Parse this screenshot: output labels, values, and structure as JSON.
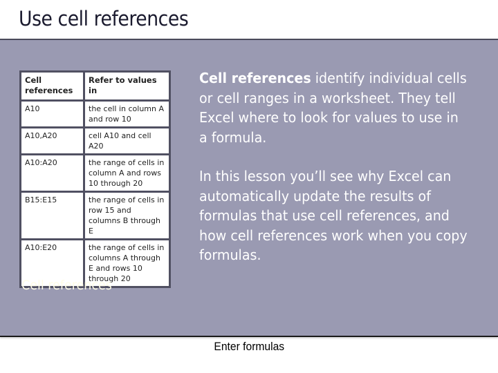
{
  "slide": {
    "title": "Use cell references",
    "table": {
      "headers": [
        "Cell references",
        "Refer to values in"
      ],
      "rows": [
        [
          "A10",
          "the cell in column A and row 10"
        ],
        [
          "A10,A20",
          "cell A10 and cell A20"
        ],
        [
          "A10:A20",
          "the range of cells in column A and rows 10 through 20"
        ],
        [
          "B15:E15",
          "the range of cells in row 15 and columns B through E"
        ],
        [
          "A10:E20",
          "the range of cells in columns A through E and rows 10 through 20"
        ]
      ]
    },
    "table_caption": "Cell references",
    "paragraph1": {
      "bold_lead": "Cell references",
      "rest": " identify individual cells or cell ranges in a worksheet. They tell Excel where to look for values to use in a formula."
    },
    "paragraph2": "In this lesson you’ll see why Excel can automatically update the results of formulas that use cell references, and how cell references work when you copy formulas.",
    "footer": "Enter formulas"
  },
  "colors": {
    "panel": "#9a9ab2",
    "table_border": "#505062",
    "caption": "#fffde8"
  }
}
